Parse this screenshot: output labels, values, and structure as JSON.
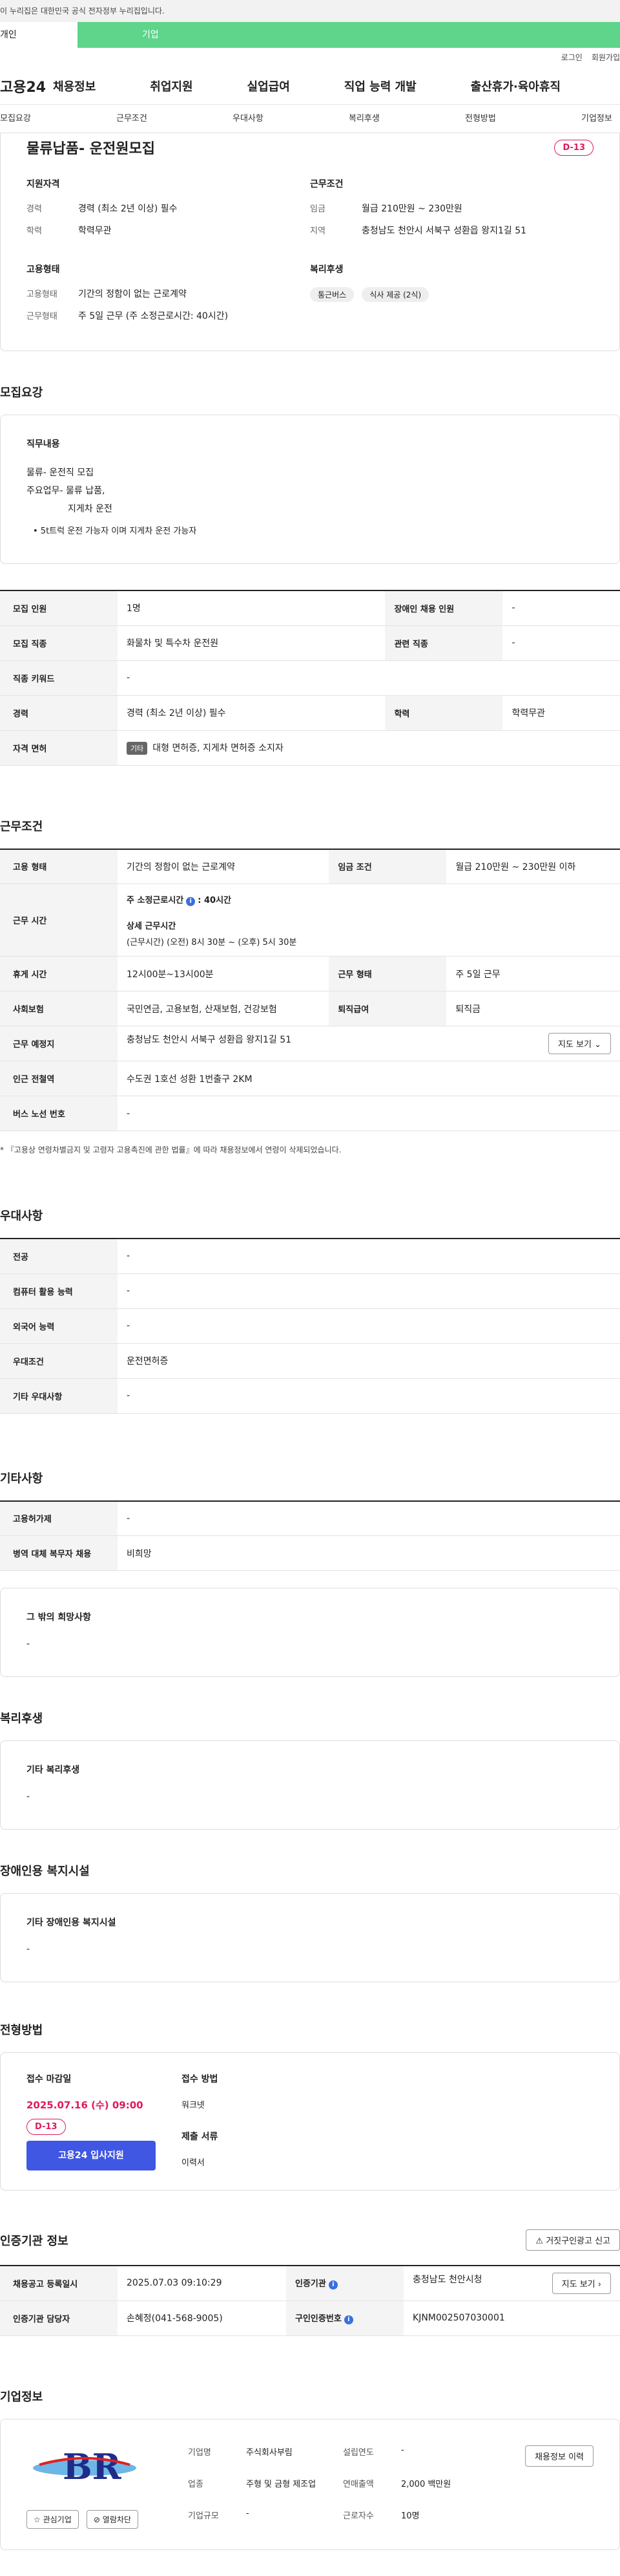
{
  "gov_notice": "이 누리집은 대한민국 공식 전자정부 누리집입니다.",
  "tabs": [
    "개인",
    "기업"
  ],
  "util": [
    "로그인",
    "회원가입"
  ],
  "logo": "고용24",
  "gnb": [
    "채용정보",
    "취업지원",
    "실업급여",
    "직업 능력 개발",
    "출산휴가·육아휴직"
  ],
  "lnb": [
    "모집요강",
    "근무조건",
    "우대사항",
    "복리후생",
    "전형방법",
    "기업정보"
  ],
  "summary": {
    "title": "물류납품- 운전원모집",
    "dday": "D-13",
    "qual_title": "지원자격",
    "qual": [
      {
        "k": "경력",
        "v": "경력 (최소 2년 이상) 필수"
      },
      {
        "k": "학력",
        "v": "학력무관"
      }
    ],
    "cond_title": "근무조건",
    "cond": [
      {
        "k": "임금",
        "v": "월급 210만원 ~ 230만원"
      },
      {
        "k": "지역",
        "v": "충청남도 천안시 서북구 성환읍 왕지1길 51"
      }
    ],
    "emp_title": "고용형태",
    "emp": [
      {
        "k": "고용형태",
        "v": "기간의 정함이 없는 근로계약"
      },
      {
        "k": "근무형태",
        "v": "주 5일 근무 (주 소정근로시간: 40시간)"
      }
    ],
    "welfare_title": "복리후생",
    "welfare_chips": [
      "통근버스",
      "식사 제공 (2식)"
    ]
  },
  "recruit": {
    "heading": "모집요강",
    "job_title": "직무내용",
    "job_lines": [
      "물류- 운전직 모집",
      "주요업무- 물류 납품,",
      "지게차 운전",
      "• 5t트럭 운전 가능자 이며 지게차 운전 가능자"
    ],
    "rows": [
      {
        "k1": "모집 인원",
        "v1": "1명",
        "k2": "장애인 채용 인원",
        "v2": "-"
      },
      {
        "k1": "모집 직종",
        "v1": "화물차 및 특수차 운전원",
        "k2": "관련 직종",
        "v2": "-"
      },
      {
        "k1": "직종 키워드",
        "v1": "-"
      },
      {
        "k1": "경력",
        "v1": "경력 (최소 2년 이상) 필수",
        "k2": "학력",
        "v2": "학력무관"
      },
      {
        "k1": "자격 면허",
        "badge": "기타",
        "v1": "대형 면허증, 지게차 면허증 소지자"
      }
    ]
  },
  "work": {
    "heading": "근무조건",
    "emp_type_k": "고용 형태",
    "emp_type_v": "기간의 정함이 없는 근로계약",
    "wage_k": "임금 조건",
    "wage_v": "월급 210만원 ~ 230만원 이하",
    "hours_k": "근무 시간",
    "hours_main": "주 소정근로시간",
    "hours_value": "40시간",
    "hours_detail_title": "상세 근무시간",
    "hours_detail": "(근무시간) (오전) 8시 30분 ~ (오후) 5시 30분",
    "rest_k": "휴게 시간",
    "rest_v": "12시00분~13시00분",
    "type_k": "근무 형태",
    "type_v": "주 5일 근무",
    "ins_k": "사회보험",
    "ins_v": "국민연금, 고용보험, 산재보험, 건강보험",
    "sev_k": "퇴직급여",
    "sev_v": "퇴직금",
    "loc_k": "근무 예정지",
    "loc_v": "충청남도 천안시 서북구 성환읍 왕지1길 51",
    "map_btn": "지도 보기",
    "station_k": "인근 전철역",
    "station_v": "수도권 1호선 성환 1번출구 2KM",
    "bus_k": "버스 노선 번호",
    "bus_v": "-",
    "note": "* 『고용상 연령차별금지 및 고령자 고용촉진에 관한 법률』에 따라 채용정보에서 연령이 삭제되었습니다."
  },
  "pref": {
    "heading": "우대사항",
    "rows": [
      {
        "k": "전공",
        "v": "-"
      },
      {
        "k": "컴퓨터 활용 능력",
        "v": "-"
      },
      {
        "k": "외국어 능력",
        "v": "-"
      },
      {
        "k": "우대조건",
        "v": "운전면허증"
      },
      {
        "k": "기타 우대사항",
        "v": "-"
      }
    ]
  },
  "etc": {
    "heading": "기타사항",
    "rows": [
      {
        "k": "고용허가제",
        "v": "-"
      },
      {
        "k": "병역 대체 복무자 채용",
        "v": "비희망"
      }
    ],
    "box_title": "그 밖의 희망사항",
    "box_value": "-"
  },
  "benefit": {
    "heading": "복리후생",
    "title": "기타 복리후생",
    "value": "-"
  },
  "disabled": {
    "heading": "장애인용 복지시설",
    "title": "기타 장애인용 복지시설",
    "value": "-"
  },
  "apply": {
    "heading": "전형방법",
    "deadline_label": "접수 마감일",
    "deadline": "2025.07.16 (수) 09:00",
    "dday": "D-13",
    "button": "고용24 입사지원",
    "method_label": "접수 방법",
    "method": "워크넷",
    "docs_label": "제출 서류",
    "docs": "이력서"
  },
  "agency": {
    "heading": "인증기관 정보",
    "report_btn": "거짓구인광고 신고",
    "r1k1": "채용공고 등록일시",
    "r1v1": "2025.07.03 09:10:29",
    "r1k2": "인증기관",
    "r1v2": "충청남도 천안시청",
    "map_btn": "지도 보기",
    "r2k1": "인증기관 담당자",
    "r2v1": "손혜정(041-568-9005)",
    "r2k2": "구인인증번호",
    "r2v2": "KJNM002507030001"
  },
  "company": {
    "heading": "기업정보",
    "logo_text": "BR",
    "fav_btn": "관심기업",
    "block_btn": "열람차단",
    "fields": [
      {
        "k": "기업명",
        "v": "주식회사부림"
      },
      {
        "k": "설립연도",
        "v": "-"
      },
      {
        "k": "업종",
        "v": "주형 및 금형 제조업"
      },
      {
        "k": "연매출액",
        "v": "2,000 백만원"
      },
      {
        "k": "기업규모",
        "v": "-"
      },
      {
        "k": "근로자수",
        "v": "10명"
      }
    ],
    "more_btn": "채용정보 이력"
  }
}
